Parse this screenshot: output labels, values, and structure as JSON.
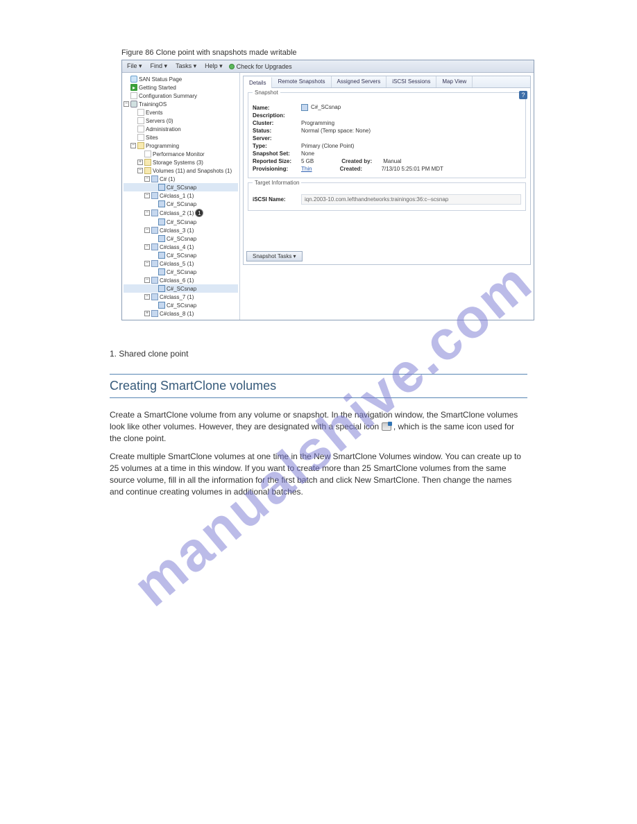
{
  "figure_caption": "Figure 86 Clone point with snapshots made writable",
  "menu": {
    "file": "File ▾",
    "find": "Find ▾",
    "tasks": "Tasks ▾",
    "help": "Help ▾",
    "upgrades": "Check for Upgrades"
  },
  "tree": {
    "san_status": "SAN Status Page",
    "getting_started": "Getting Started",
    "config_summary": "Configuration Summary",
    "training": "TrainingOS",
    "events": "Events",
    "servers": "Servers (0)",
    "admin": "Administration",
    "sites": "Sites",
    "programming": "Programming",
    "perf_monitor": "Performance Monitor",
    "storage_systems": "Storage Systems (3)",
    "vol_snaps": "Volumes (11) and Snapshots (1)",
    "c1": "C# (1)",
    "c1_snap": "C#_SCsnap",
    "cc1": "C#class_1 (1)",
    "cc1_snap": "C#_SCsnap",
    "cc2": "C#class_2 (1)",
    "cc2_snap": "C#_SCsnap",
    "cc3": "C#class_3 (1)",
    "cc3_snap": "C#_SCsnap",
    "cc4": "C#class_4 (1)",
    "cc4_snap": "C#_SCsnap",
    "cc5": "C#class_5 (1)",
    "cc5_snap": "C#_SCsnap",
    "cc6": "C#class_6 (1)",
    "cc6_snap": "C#_SCsnap",
    "cc7": "C#class_7 (1)",
    "cc7_snap": "C#_SCsnap",
    "cc8": "C#class_8 (1)"
  },
  "tabs": {
    "details": "Details",
    "remote": "Remote Snapshots",
    "assigned": "Assigned Servers",
    "iscsi": "iSCSI Sessions",
    "map": "Map View"
  },
  "details": {
    "group1_title": "Snapshot",
    "name_k": "Name:",
    "name_v": "C#_SCsnap",
    "desc_k": "Description:",
    "cluster_k": "Cluster:",
    "cluster_v": "Programming",
    "status_k": "Status:",
    "status_v": "Normal (Temp space: None)",
    "server_k": "Server:",
    "type_k": "Type:",
    "type_v": "Primary (Clone Point)",
    "snapset_k": "Snapshot Set:",
    "snapset_v": "None",
    "repsize_k": "Reported Size:",
    "repsize_v": "5 GB",
    "createdby_k": "Created by:",
    "createdby_v": "Manual",
    "prov_k": "Provisioning:",
    "prov_v": "Thin",
    "created_k": "Created:",
    "created_v": "7/13/10 5:25:01 PM MDT",
    "group2_title": "Target Information",
    "iscsi_k": "iSCSI Name:",
    "iscsi_v": "iqn.2003-10.com.lefthandnetworks:trainingos:36:c--scsnap",
    "snap_tasks": "Snapshot Tasks ▾",
    "marker": "1"
  },
  "content": {
    "item1": "1. Shared clone point",
    "section_title": "Creating SmartClone volumes",
    "p1_pre": "Create a SmartClone volume from any volume or snapshot. In the navigation window, the SmartClone volumes look like other volumes. However, they are designated with a special icon ",
    "p1_post": ", which is the same icon used for the clone point.",
    "p1_icon_name": "smartclone-icon",
    "p2": "Create multiple SmartClone volumes at one time in the New SmartClone Volumes window. You can create up to 25 volumes at a time in this window. If you want to create more than 25 SmartClone volumes from the same source volume, fill in all the information for the first batch and click New SmartClone. Then change the names and continue creating volumes in additional batches."
  },
  "watermark": "manualshive.com"
}
